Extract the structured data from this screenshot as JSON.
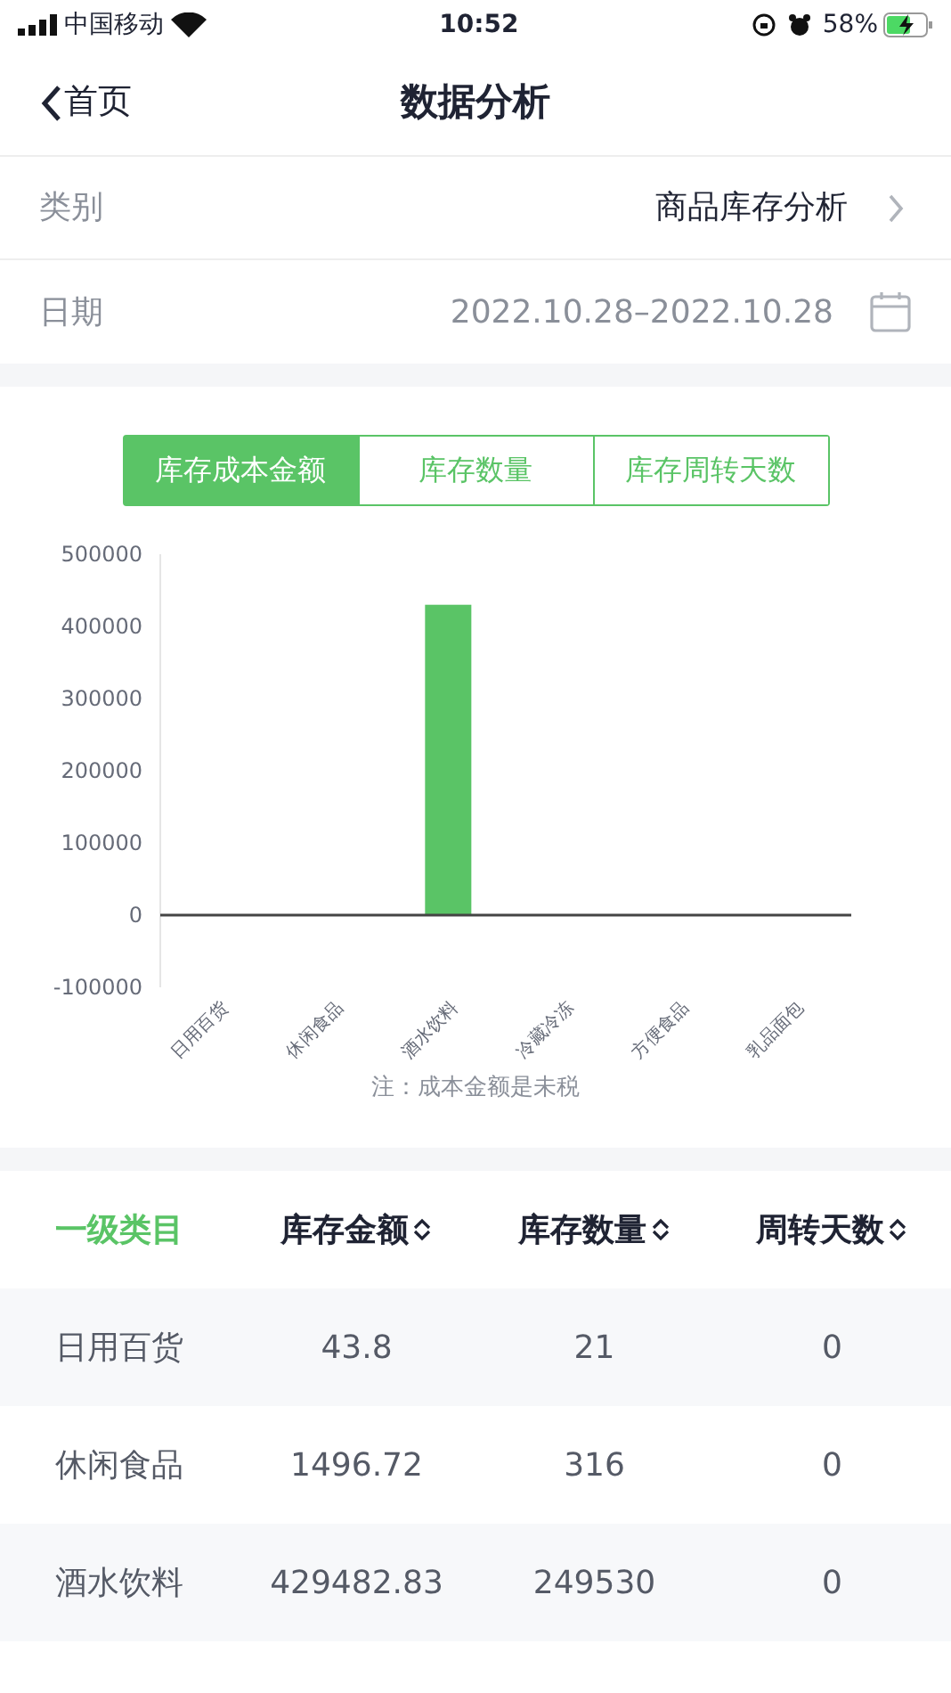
{
  "status_bar": {
    "carrier": "中国移动",
    "time": "10:52",
    "battery": "58%"
  },
  "nav": {
    "back": "首页",
    "title": "数据分析"
  },
  "filters": [
    {
      "label": "类别",
      "value": "商品库存分析",
      "kind": "chevron"
    },
    {
      "label": "日期",
      "value": "2022.10.28–2022.10.28",
      "kind": "calendar"
    }
  ],
  "metric_tabs": [
    {
      "label": "库存成本金额",
      "selected": true
    },
    {
      "label": "库存数量",
      "selected": false
    },
    {
      "label": "库存周转天数",
      "selected": false
    }
  ],
  "chart_data": {
    "type": "bar",
    "categories": [
      "日用百货",
      "休闲食品",
      "酒水饮料",
      "冷藏冷冻",
      "方便食品",
      "乳品面包"
    ],
    "series": [
      {
        "color": "#5ac466",
        "values": [
          0,
          0,
          430000,
          0,
          0,
          0
        ]
      }
    ],
    "ylim": [
      -100000,
      500000
    ],
    "yticks": [
      -100000,
      0,
      100000,
      200000,
      300000,
      400000,
      500000
    ]
  },
  "chart_note": "注：成本金额是未税",
  "table": {
    "columns": [
      {
        "label": "一级类目",
        "sortable": false
      },
      {
        "label": "库存金额",
        "sortable": true
      },
      {
        "label": "库存数量",
        "sortable": true
      },
      {
        "label": "周转天数",
        "sortable": true
      }
    ],
    "rows": [
      [
        "日用百货",
        "43.8",
        "21",
        "0"
      ],
      [
        "休闲食品",
        "1496.72",
        "316",
        "0"
      ],
      [
        "酒水饮料",
        "429482.83",
        "249530",
        "0"
      ]
    ]
  }
}
